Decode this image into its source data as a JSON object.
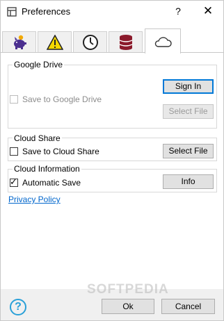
{
  "window": {
    "title": "Preferences",
    "help_glyph": "?",
    "close_glyph": "✕"
  },
  "tabs": [
    {
      "name": "piggy-bank-icon",
      "active": false
    },
    {
      "name": "warning-icon",
      "active": false
    },
    {
      "name": "clock-icon",
      "active": false
    },
    {
      "name": "database-icon",
      "active": false
    },
    {
      "name": "cloud-icon",
      "active": true
    }
  ],
  "google_drive": {
    "title": "Google Drive",
    "checkbox_label": "Save to Google Drive",
    "checked": false,
    "enabled": false,
    "sign_in_label": "Sign In",
    "select_file_label": "Select File"
  },
  "cloud_share": {
    "title": "Cloud Share",
    "checkbox_label": "Save to Cloud Share",
    "checked": false,
    "select_file_label": "Select File"
  },
  "cloud_info": {
    "title": "Cloud Information",
    "checkbox_label": "Automatic Save",
    "checked": true,
    "info_label": "Info"
  },
  "privacy_link": "Privacy Policy",
  "footer": {
    "help_glyph": "?",
    "ok_label": "Ok",
    "cancel_label": "Cancel"
  },
  "watermark": "SOFTPEDIA",
  "colors": {
    "accent": "#0078d7",
    "link": "#0066cc",
    "help": "#29a0d8",
    "piggy": "#4b2f8f",
    "coin": "#f2a900",
    "warning": "#f5d800",
    "database": "#8b1a2b"
  }
}
